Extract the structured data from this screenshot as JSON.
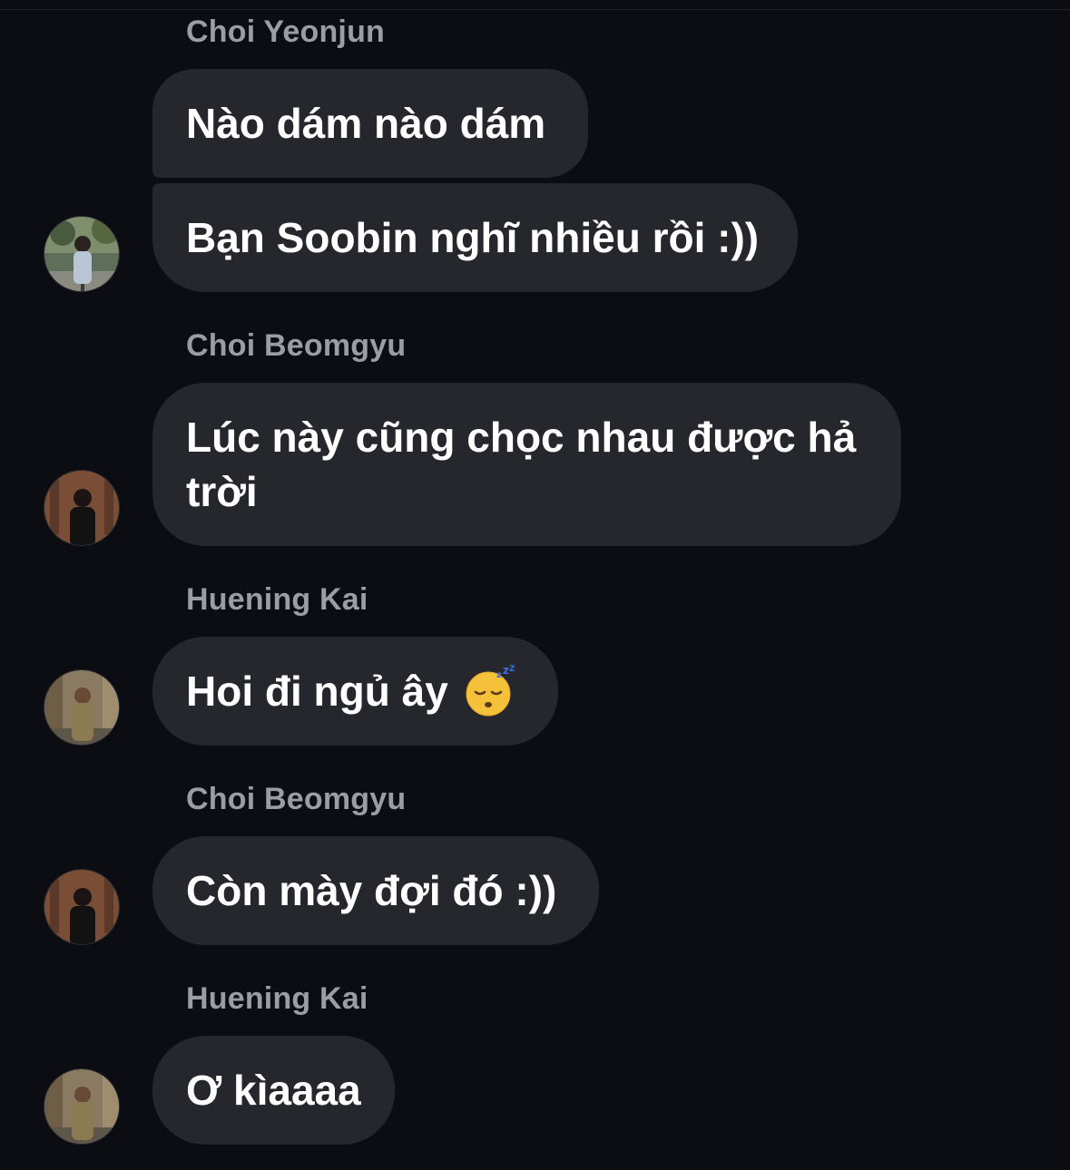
{
  "colors": {
    "background": "#0b0d12",
    "bubble": "#25272c",
    "sender_name": "#9a9da4",
    "message_text": "#ffffff"
  },
  "messages": [
    {
      "sender": "Choi Yeonjun",
      "lines": [
        "Nào dám nào dám",
        "Bạn Soobin nghĩ nhiều rồi :))"
      ],
      "avatar": "avatar-choi-yeonjun"
    },
    {
      "sender": "Choi Beomgyu",
      "lines": [
        "Lúc này cũng chọc nhau được hả trời"
      ],
      "avatar": "avatar-choi-beomgyu"
    },
    {
      "sender": "Huening Kai",
      "lines": [
        "Hoi đi ngủ ây"
      ],
      "emoji": "sleeping-face-emoji",
      "avatar": "avatar-huening-kai"
    },
    {
      "sender": "Choi Beomgyu",
      "lines": [
        "Còn mày đợi đó :))"
      ],
      "avatar": "avatar-choi-beomgyu"
    },
    {
      "sender": "Huening Kai",
      "lines": [
        "Ơ kìaaaa"
      ],
      "avatar": "avatar-huening-kai"
    }
  ]
}
